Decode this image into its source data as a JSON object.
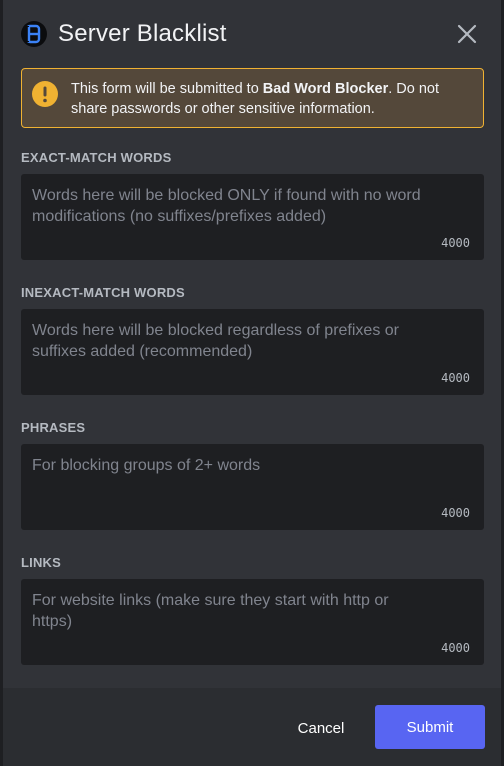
{
  "modal": {
    "title": "Server Blacklist",
    "app_icon": "bad-word-blocker-logo",
    "close_icon": "close-icon"
  },
  "notice": {
    "icon": "warning-icon",
    "text_before": "This form will be submitted to ",
    "app_name": "Bad Word Blocker",
    "text_after": ". Do not share passwords or other sensitive information."
  },
  "fields": [
    {
      "label": "EXACT-MATCH WORDS",
      "value": "",
      "placeholder": "Words here will be blocked ONLY if found with no word modifications (no suffixes/prefixes added)",
      "counter": "4000"
    },
    {
      "label": "INEXACT-MATCH WORDS",
      "value": "",
      "placeholder": "Words here will be blocked regardless of prefixes or suffixes added (recommended)",
      "counter": "4000"
    },
    {
      "label": "PHRASES",
      "value": "",
      "placeholder": "For blocking groups of 2+ words",
      "counter": "4000"
    },
    {
      "label": "LINKS",
      "value": "",
      "placeholder": "For website links (make sure they start with http or https)",
      "counter": "4000"
    }
  ],
  "footer": {
    "cancel_label": "Cancel",
    "submit_label": "Submit"
  },
  "colors": {
    "accent": "#5865f2",
    "warning": "#f0b232",
    "background": "#313338",
    "input_background": "#1e1f22"
  }
}
